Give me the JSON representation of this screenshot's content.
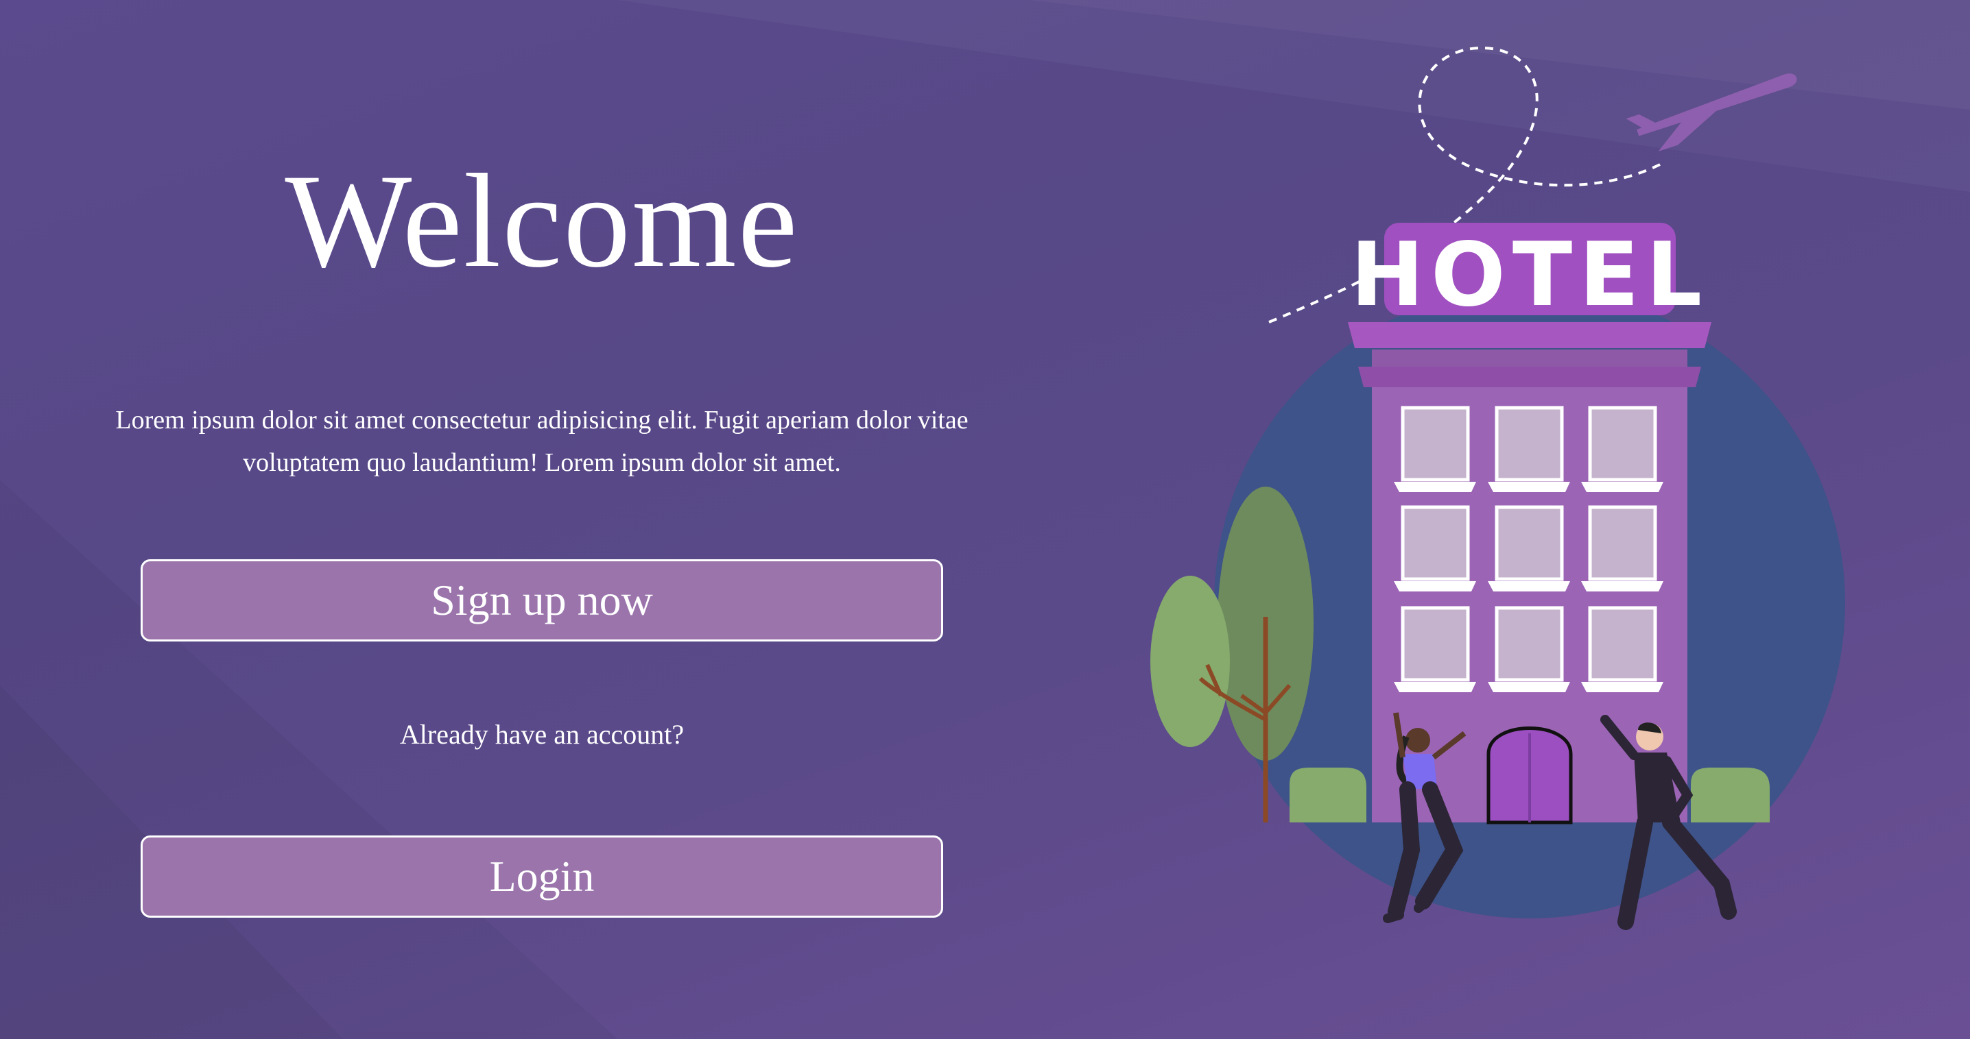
{
  "page": {
    "title": "Welcome",
    "description": "Lorem ipsum dolor sit amet consectetur adipisicing elit. Fugit aperiam dolor vitae voluptatem quo laudantium! Lorem ipsum dolor sit amet.",
    "signup_label": "Sign up now",
    "already_text": "Already have an account?",
    "login_label": "Login"
  },
  "illustration": {
    "sign_text": "HOTEL"
  },
  "colors": {
    "background_start": "#5b4a8d",
    "button_fill": "#9a74ab",
    "button_border": "#ffffff",
    "hotel_purple": "#9b64b5",
    "circle_blue": "#3e5389"
  },
  "icons": [
    "hotel-building-illustration",
    "airplane-icon",
    "tree-icon",
    "bush-icon",
    "person-figure"
  ]
}
